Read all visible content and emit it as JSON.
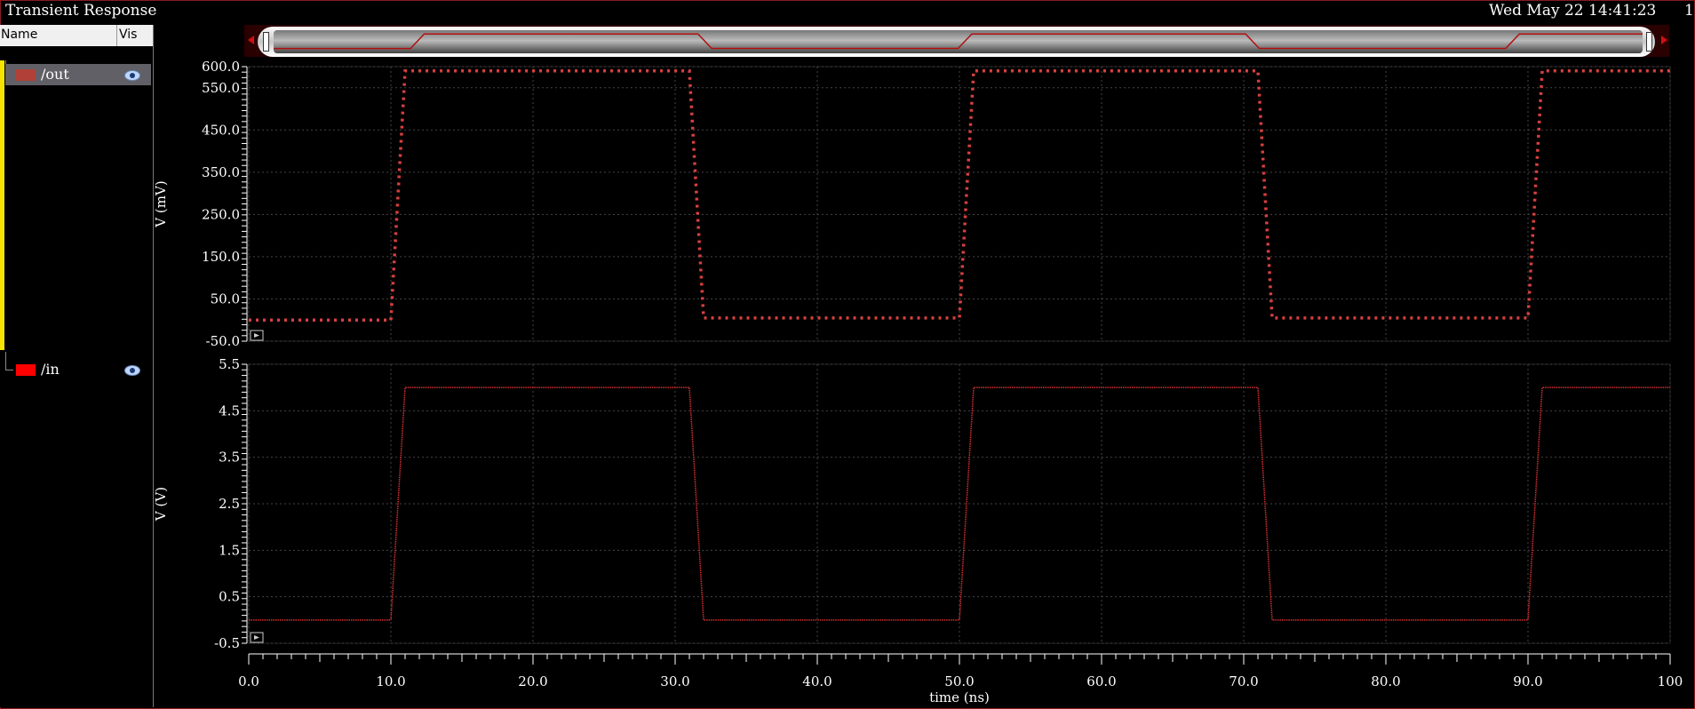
{
  "window": {
    "title": "Transient Response",
    "datetime": "Wed May 22 14:41:23",
    "page_number": "1"
  },
  "colors": {
    "out_trace": "#d84040",
    "in_trace": "#d83030",
    "grid": "#444444",
    "scroll_marker": "#b01010"
  },
  "signal_list": {
    "header": {
      "name": "Name",
      "vis": "Vis"
    },
    "items": [
      {
        "label": "/out",
        "swatch": "#b04038",
        "visible": true,
        "icon": "eye-icon"
      },
      {
        "label": "/in",
        "swatch": "#ff0000",
        "visible": true,
        "icon": "eye-icon"
      }
    ]
  },
  "chart_data": [
    {
      "type": "line",
      "series": [
        {
          "name": "/out",
          "x": [
            0,
            10,
            11,
            31,
            32,
            50,
            51,
            71,
            72,
            90,
            91,
            100
          ],
          "y": [
            0,
            0,
            590,
            590,
            5,
            5,
            590,
            590,
            5,
            5,
            590,
            590
          ]
        }
      ],
      "ylabel": "V (mV)",
      "ylim": [
        -50,
        600
      ],
      "y_ticks": [
        "600.0",
        "550.0",
        "450.0",
        "350.0",
        "250.0",
        "150.0",
        "50.0",
        "-50.0"
      ],
      "xlim": [
        0,
        100
      ],
      "grid": true
    },
    {
      "type": "line",
      "series": [
        {
          "name": "/in",
          "x": [
            0,
            10,
            11,
            31,
            32,
            50,
            51,
            71,
            72,
            90,
            91,
            100
          ],
          "y": [
            0,
            0,
            5,
            5,
            0,
            0,
            5,
            5,
            0,
            0,
            5,
            5
          ]
        }
      ],
      "ylabel": "V (V)",
      "xlabel": "time (ns)",
      "ylim": [
        -0.5,
        5.5
      ],
      "y_ticks": [
        "5.5",
        "4.5",
        "3.5",
        "2.5",
        "1.5",
        "0.5",
        "-0.5"
      ],
      "xlim": [
        0,
        100
      ],
      "x_ticks": [
        "0.0",
        "10.0",
        "20.0",
        "30.0",
        "40.0",
        "50.0",
        "60.0",
        "70.0",
        "80.0",
        "90.0",
        "100"
      ],
      "grid": true
    }
  ]
}
